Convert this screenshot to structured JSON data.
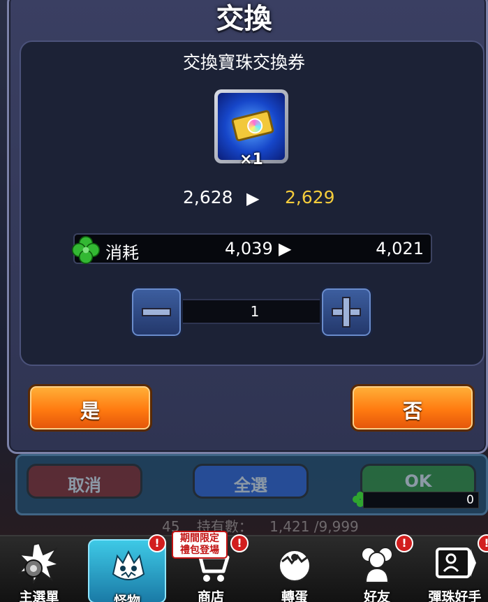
{
  "dialog": {
    "title": "交換",
    "item_name": "交換寶珠交換券",
    "item_quantity": "×1",
    "count_from": "2,628",
    "count_to": "2,629",
    "cost_label": "消耗",
    "cost_from": "4,039",
    "cost_to": "4,021",
    "stepper_value": "1",
    "yes_label": "是",
    "no_label": "否"
  },
  "background_panel": {
    "cancel_label": "取消",
    "select_all_label": "全選",
    "ok_label": "OK",
    "ok_count": "0",
    "owned_left": "45",
    "owned_label": "持有數：",
    "owned_value": "1,421 /9,999"
  },
  "bottom_nav": {
    "promo_text": "期間限定\n禮包登場",
    "items": [
      {
        "label": "主選單",
        "icon": "main-menu-icon"
      },
      {
        "label": "怪物",
        "icon": "monster-icon"
      },
      {
        "label": "商店",
        "icon": "shop-cart-icon"
      },
      {
        "label": "轉蛋",
        "icon": "gacha-egg-icon"
      },
      {
        "label": "好友",
        "icon": "friends-icon"
      },
      {
        "label": "彈珠好手",
        "icon": "strike-player-icon"
      }
    ],
    "alert_glyph": "!"
  },
  "colors": {
    "highlight_value": "#f4cc3c",
    "yes_no_button": "#ff7a10",
    "active_tab": "#3ec9e6"
  }
}
